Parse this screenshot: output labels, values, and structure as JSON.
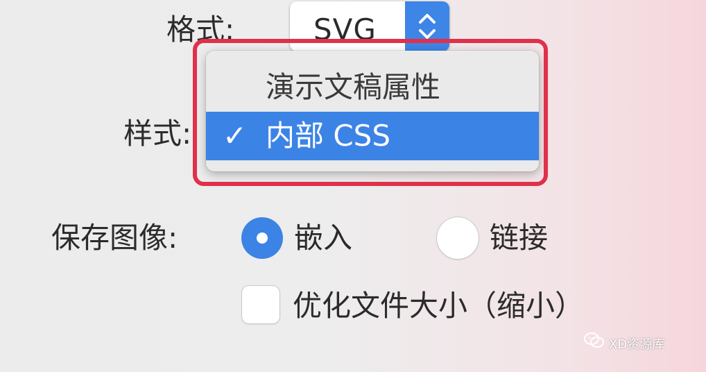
{
  "format": {
    "label": "格式:",
    "value": "SVG"
  },
  "style": {
    "label": "样式:",
    "menu_items": [
      {
        "label": "演示文稿属性",
        "selected": false
      },
      {
        "label": "内部 CSS",
        "selected": true
      }
    ],
    "check_glyph": "✓"
  },
  "save_images": {
    "label": "保存图像:",
    "options": [
      {
        "label": "嵌入",
        "selected": true
      },
      {
        "label": "链接",
        "selected": false
      }
    ]
  },
  "optimize": {
    "label": "优化文件大小（缩小）",
    "checked": false
  },
  "watermark": {
    "text": "XD资源库",
    "icon": "wechat-icon"
  },
  "colors": {
    "accent": "#3c83e6",
    "highlight_border": "#e0304a"
  }
}
